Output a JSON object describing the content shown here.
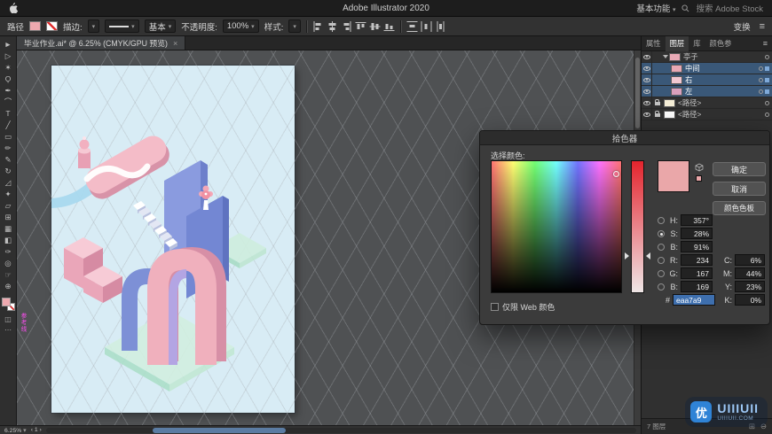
{
  "app_title": "Adobe Illustrator 2020",
  "menu": {
    "workspace": "基本功能",
    "search": "搜索 Adobe Stock"
  },
  "control_bar": {
    "target_label": "路径",
    "stroke_label": "描边:",
    "brush": "基本",
    "opacity_label": "不透明度:",
    "opacity": "100%",
    "style_label": "样式:",
    "transform": "变换"
  },
  "doc_tab": {
    "title": "毕业作业.ai* @ 6.25% (CMYK/GPU 预览)"
  },
  "tools": [
    {
      "name": "selection",
      "glyph": "►"
    },
    {
      "name": "direct-selection",
      "glyph": "▷"
    },
    {
      "name": "magic-wand",
      "glyph": "✶"
    },
    {
      "name": "lasso",
      "glyph": "Ϙ"
    },
    {
      "name": "pen",
      "glyph": "✒"
    },
    {
      "name": "curvature",
      "glyph": "⌒"
    },
    {
      "name": "type",
      "glyph": "T"
    },
    {
      "name": "line-segment",
      "glyph": "╱"
    },
    {
      "name": "rectangle",
      "glyph": "▭"
    },
    {
      "name": "paintbrush",
      "glyph": "✏"
    },
    {
      "name": "pencil",
      "glyph": "✎"
    },
    {
      "name": "rotate",
      "glyph": "↻"
    },
    {
      "name": "scale",
      "glyph": "◿"
    },
    {
      "name": "width",
      "glyph": "✦"
    },
    {
      "name": "free-transform",
      "glyph": "▱"
    },
    {
      "name": "shape-builder",
      "glyph": "⊞"
    },
    {
      "name": "mesh",
      "glyph": "▦"
    },
    {
      "name": "gradient",
      "glyph": "◧"
    },
    {
      "name": "eyedropper",
      "glyph": "✑"
    },
    {
      "name": "blend",
      "glyph": "◎"
    },
    {
      "name": "hand",
      "glyph": "☞"
    },
    {
      "name": "zoom",
      "glyph": "⊕"
    }
  ],
  "canvas": {
    "guide_label": "参考线",
    "zoom": "6.25%",
    "artboard_nav": "1"
  },
  "dock": {
    "tabs": [
      {
        "label": "属性",
        "active": false
      },
      {
        "label": "图层",
        "active": true
      },
      {
        "label": "库",
        "active": false
      },
      {
        "label": "颜色参",
        "active": false
      }
    ],
    "layers": [
      {
        "name": "亭子",
        "eye": true,
        "lock": false,
        "expand": true,
        "selected": false,
        "indent": 0,
        "thumb": "#e9aab6",
        "chip": true
      },
      {
        "name": "中间",
        "eye": true,
        "lock": false,
        "expand": false,
        "selected": true,
        "indent": 1,
        "thumb": "#e8a8b4",
        "chip": true
      },
      {
        "name": "右",
        "eye": true,
        "lock": false,
        "expand": false,
        "selected": true,
        "indent": 1,
        "thumb": "#f2c7d0",
        "chip": true
      },
      {
        "name": "左",
        "eye": true,
        "lock": false,
        "expand": false,
        "selected": true,
        "indent": 1,
        "thumb": "#d9a0bd",
        "chip": true
      },
      {
        "name": "<路径>",
        "eye": true,
        "lock": true,
        "expand": false,
        "selected": false,
        "indent": 0,
        "thumb": "#f4edd6",
        "chip": false
      },
      {
        "name": "<路径>",
        "eye": true,
        "lock": true,
        "expand": false,
        "selected": false,
        "indent": 0,
        "thumb": "#fbfbfb",
        "chip": false
      }
    ],
    "footer": "7 图层"
  },
  "picker": {
    "title": "拾色器",
    "prompt": "选择颜色:",
    "ok": "确定",
    "cancel": "取消",
    "swatches_btn": "颜色色板",
    "web_only": "仅限 Web 颜色",
    "hex_label": "#",
    "hex": "eaa7a9",
    "swatch": "#eaa7a9",
    "left_rows": [
      {
        "label": "H:",
        "value": "357°",
        "selected": false
      },
      {
        "label": "S:",
        "value": "28%",
        "selected": true
      },
      {
        "label": "B:",
        "value": "91%",
        "selected": false
      },
      {
        "label": "R:",
        "value": "234",
        "selected": false
      },
      {
        "label": "G:",
        "value": "167",
        "selected": false
      },
      {
        "label": "B:",
        "value": "169",
        "selected": false
      }
    ],
    "right_rows": [
      {
        "label": "C:",
        "value": "6%"
      },
      {
        "label": "M:",
        "value": "44%"
      },
      {
        "label": "Y:",
        "value": "23%"
      },
      {
        "label": "K:",
        "value": "0%"
      }
    ]
  },
  "watermark": {
    "badge": "优",
    "title": "UIIIUII",
    "sub": "UIIIUII.COM"
  },
  "icons": {
    "caret": "▾",
    "menu": "≡",
    "close": "×",
    "left": "‹",
    "right": "›",
    "mode": "◫",
    "more": "⋯",
    "new_layer": "⊞",
    "delete_layer": "⊖"
  },
  "colors": {
    "selection_blue": "#3a5878",
    "artboard": "#d8ecf5",
    "canvas_bg": "#4f5153",
    "accent_pink": "#eaa7a9"
  }
}
